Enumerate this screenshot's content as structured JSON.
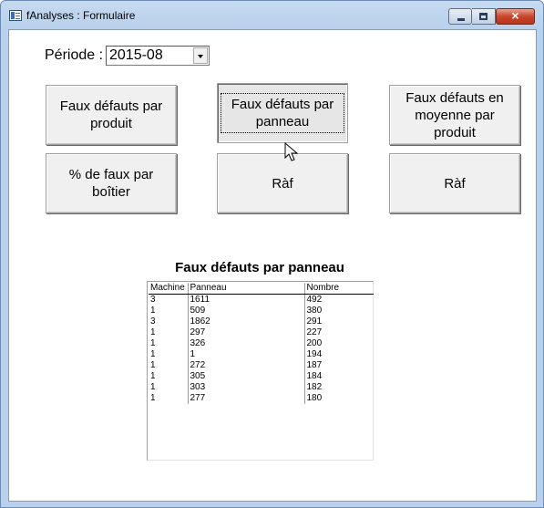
{
  "window": {
    "title": "fAnalyses : Formulaire",
    "close_glyph": "×"
  },
  "periode": {
    "label": "Période :",
    "value": "2015-08"
  },
  "buttons": {
    "b1": "Faux défauts par produit",
    "b2": "Faux défauts par panneau",
    "b3": "Faux défauts en moyenne par produit",
    "b4": "% de faux par boîtier",
    "b5": "Ràf",
    "b6": "Ràf"
  },
  "subform": {
    "title": "Faux défauts par panneau",
    "columns": [
      "Machine",
      "Panneau",
      "Nombre"
    ],
    "rows": [
      [
        "3",
        "1611",
        "492"
      ],
      [
        "1",
        "509",
        "380"
      ],
      [
        "3",
        "1862",
        "291"
      ],
      [
        "1",
        "297",
        "227"
      ],
      [
        "1",
        "326",
        "200"
      ],
      [
        "1",
        "1",
        "194"
      ],
      [
        "1",
        "272",
        "187"
      ],
      [
        "1",
        "305",
        "184"
      ],
      [
        "1",
        "303",
        "182"
      ],
      [
        "1",
        "277",
        "180"
      ]
    ]
  }
}
